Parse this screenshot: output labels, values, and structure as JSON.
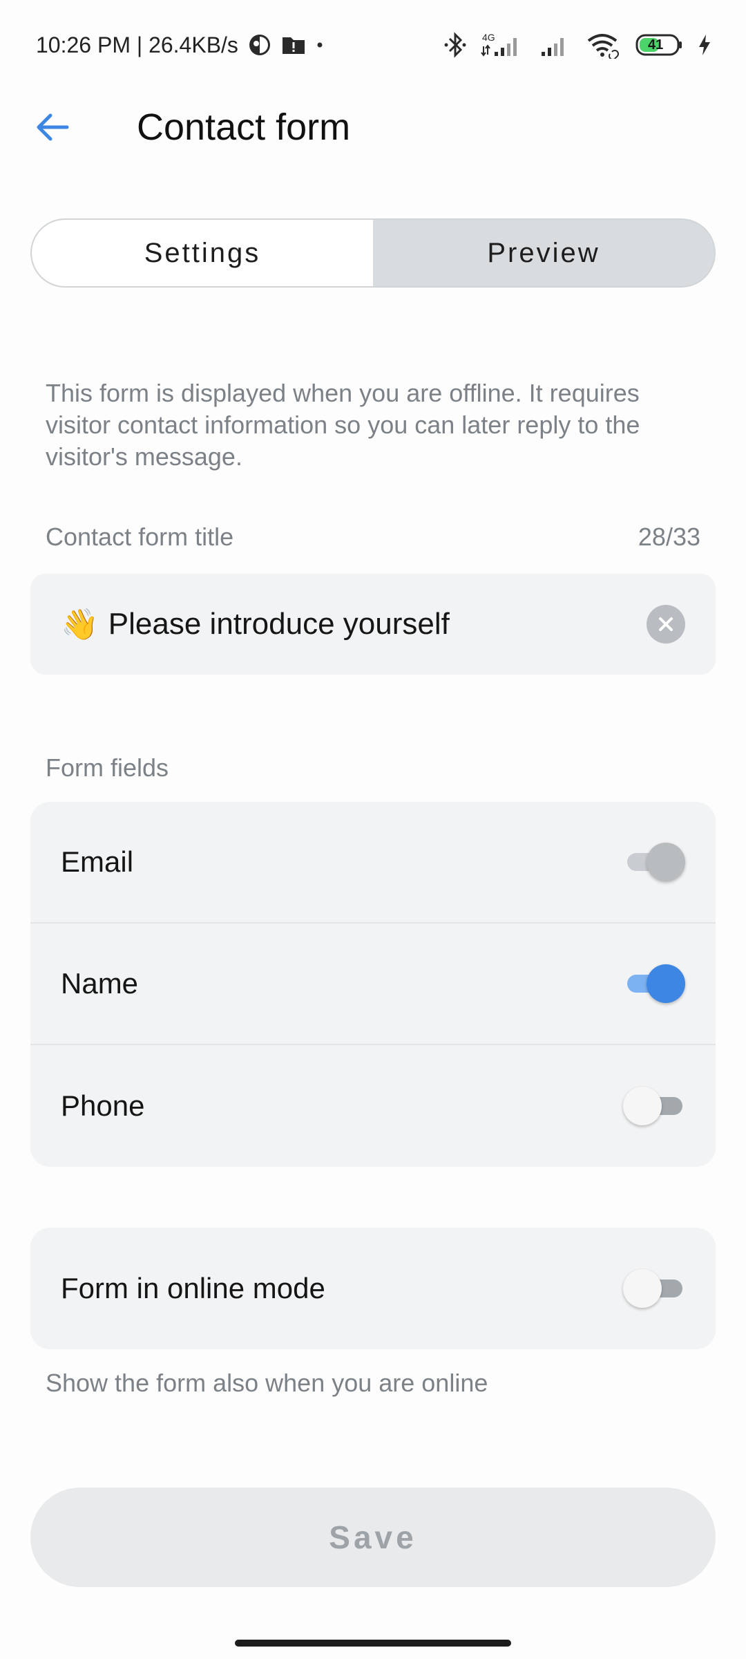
{
  "status_bar": {
    "time_speed": "10:26 PM | 26.4KB/s",
    "network_label": "4G",
    "battery": "41"
  },
  "header": {
    "title": "Contact form",
    "back_icon": "arrow-left-icon"
  },
  "tabs": [
    {
      "label": "Settings",
      "selected": true
    },
    {
      "label": "Preview",
      "selected": false
    }
  ],
  "description": "This form is displayed when you are offline. It requires visitor contact information so you can later reply to the visitor's message.",
  "title_field": {
    "label": "Contact form title",
    "counter": "28/33",
    "emoji": "👋",
    "value": "Please introduce yourself"
  },
  "form_fields": {
    "label": "Form fields",
    "items": [
      {
        "label": "Email",
        "state": "on-disabled"
      },
      {
        "label": "Name",
        "state": "on"
      },
      {
        "label": "Phone",
        "state": "off"
      }
    ]
  },
  "online_mode": {
    "label": "Form in online mode",
    "state": "off",
    "helper": "Show the form also when you are online"
  },
  "save_label": "Save",
  "colors": {
    "accent": "#3d86e4",
    "accent_track": "#7db2f2",
    "muted_text": "#7b8187"
  }
}
